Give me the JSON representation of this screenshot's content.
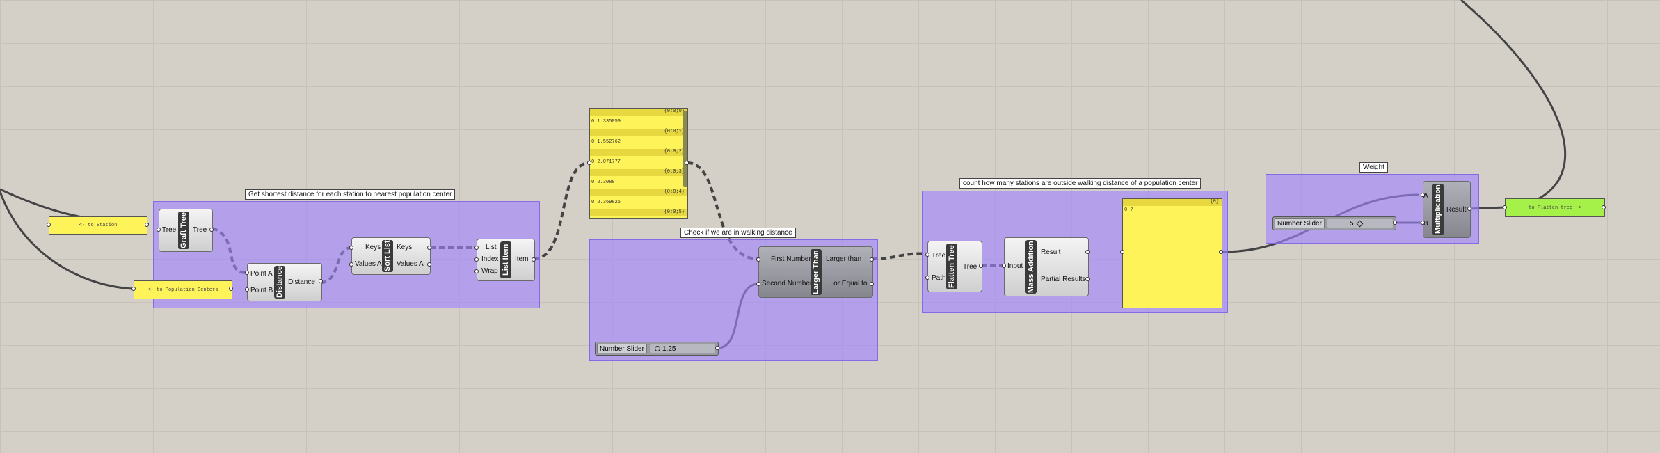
{
  "groups": {
    "shortest": {
      "label": "Get shortest distance for each station to nearest population center"
    },
    "walking": {
      "label": "Check if we are in walking distance"
    },
    "count": {
      "label": "count how many stations are outside walking distance of a population center"
    },
    "weight": {
      "label": "Weight"
    }
  },
  "params": {
    "station": "<- to Station",
    "population": "<- to Population Centers",
    "flatten_out": "to Flatten tree ->"
  },
  "components": {
    "graft": {
      "name": "Graft Tree",
      "in": "Tree",
      "out": "Tree"
    },
    "distance": {
      "name": "Distance",
      "in_a": "Point A",
      "in_b": "Point B",
      "out": "Distance"
    },
    "sort": {
      "name": "Sort List",
      "in_keys": "Keys",
      "in_values": "Values A",
      "out_keys": "Keys",
      "out_values": "Values A"
    },
    "listitem": {
      "name": "List Item",
      "in_list": "List",
      "in_index": "Index",
      "in_wrap": "Wrap",
      "out": "Item"
    },
    "larger": {
      "name": "Larger Than",
      "in_first": "First Number",
      "in_second": "Second Number",
      "out_larger": "Larger than",
      "out_equal": "... or Equal to"
    },
    "flatten": {
      "name": "Flatten Tree",
      "in_tree": "Tree",
      "in_path": "Path",
      "out": "Tree"
    },
    "massadd": {
      "name": "Mass Addition",
      "in": "Input",
      "out_result": "Result",
      "out_partial": "Partial Results"
    },
    "mult": {
      "name": "Multiplication",
      "in_a": "A",
      "in_b": "B",
      "out": "Result"
    }
  },
  "sliders": {
    "walking": {
      "label": "Number Slider",
      "value": "1.25"
    },
    "weight": {
      "label": "Number Slider",
      "value": "5"
    }
  },
  "panel_list": {
    "head": "{0;0;0}",
    "rows": [
      {
        "path": "{0;0;0}",
        "value": "0 1.335859"
      },
      {
        "path": "{0;0;1}",
        "value": "0 1.552762"
      },
      {
        "path": "{0;0;2}",
        "value": "0 2.071777"
      },
      {
        "path": "{0;0;3}",
        "value": "0 2.3088"
      },
      {
        "path": "{0;0;4}",
        "value": "0 2.369826"
      },
      {
        "path": "{0;0;5}",
        "value": ""
      }
    ]
  },
  "panel_result": {
    "path": "{0}",
    "value": "0 ?"
  }
}
